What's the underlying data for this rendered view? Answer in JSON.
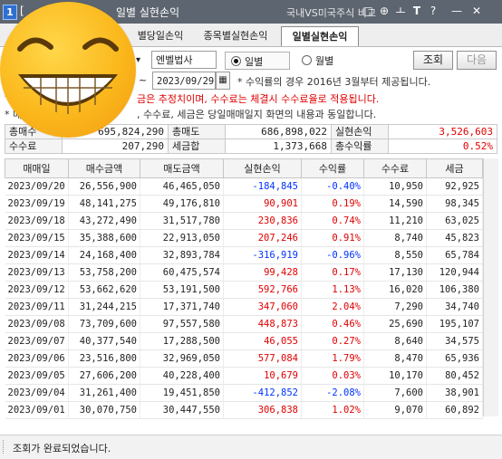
{
  "window": {
    "number": "1",
    "title": "일별 실현손익",
    "title_prefix": "[",
    "compare_label": "국내VS미국주식 비교",
    "buttons": [
      "□",
      "⊕",
      "ㅗ",
      "T",
      "?",
      "—",
      "✕"
    ]
  },
  "tabs": [
    {
      "label": "별당일손익",
      "active": false
    },
    {
      "label": "종목별실현손익",
      "active": false
    },
    {
      "label": "일별실현손익",
      "active": true
    }
  ],
  "controls": {
    "account_name": "엔벨법사",
    "date_sep": "~",
    "date_value": "2023/09/29",
    "radio_daily": "일별",
    "radio_monthly": "월별",
    "radio_selected": "daily",
    "query_button": "조회",
    "next_button": "다음"
  },
  "notes": {
    "line1": "* 수익률의 경우 2016년 3월부터 제공됩니다.",
    "line2": "금은 추정치이며, 수수료는 체결시 수수료율로 적용됩니다.",
    "line3_a": "* 매",
    "line3_b": ", 수수료, 세금은 당일매매일지 화면의 내용과 동일합니다.",
    "line2_prefix": "*"
  },
  "summary": {
    "total_buy_label": "총매수",
    "total_buy": "695,824,290",
    "total_sell_label": "총매도",
    "total_sell": "686,898,022",
    "realized_label": "실현손익",
    "realized": "3,526,603",
    "fee_label": "수수료",
    "fee": "207,290",
    "tax_label": "세금합",
    "tax": "1,373,668",
    "total_return_label": "총수익률",
    "total_return": "0.52%"
  },
  "table": {
    "headers": [
      "매매일",
      "매수금액",
      "매도금액",
      "실현손익",
      "수익률",
      "수수료",
      "세금"
    ],
    "rows": [
      [
        "2023/09/20",
        "26,556,900",
        "46,465,050",
        "-184,845",
        "-0.40%",
        "10,950",
        "92,925"
      ],
      [
        "2023/09/19",
        "48,141,275",
        "49,176,810",
        "90,901",
        "0.19%",
        "14,590",
        "98,345"
      ],
      [
        "2023/09/18",
        "43,272,490",
        "31,517,780",
        "230,836",
        "0.74%",
        "11,210",
        "63,025"
      ],
      [
        "2023/09/15",
        "35,388,600",
        "22,913,050",
        "207,246",
        "0.91%",
        "8,740",
        "45,823"
      ],
      [
        "2023/09/14",
        "24,168,400",
        "32,893,784",
        "-316,919",
        "-0.96%",
        "8,550",
        "65,784"
      ],
      [
        "2023/09/13",
        "53,758,200",
        "60,475,574",
        "99,428",
        "0.17%",
        "17,130",
        "120,944"
      ],
      [
        "2023/09/12",
        "53,662,620",
        "53,191,500",
        "592,766",
        "1.13%",
        "16,020",
        "106,380"
      ],
      [
        "2023/09/11",
        "31,244,215",
        "17,371,740",
        "347,060",
        "2.04%",
        "7,290",
        "34,740"
      ],
      [
        "2023/09/08",
        "73,709,600",
        "97,557,580",
        "448,873",
        "0.46%",
        "25,690",
        "195,107"
      ],
      [
        "2023/09/07",
        "40,377,540",
        "17,288,500",
        "46,055",
        "0.27%",
        "8,640",
        "34,575"
      ],
      [
        "2023/09/06",
        "23,516,800",
        "32,969,050",
        "577,084",
        "1.79%",
        "8,470",
        "65,936"
      ],
      [
        "2023/09/05",
        "27,606,200",
        "40,228,400",
        "10,679",
        "0.03%",
        "10,170",
        "80,452"
      ],
      [
        "2023/09/04",
        "31,261,400",
        "19,451,850",
        "-412,852",
        "-2.08%",
        "7,600",
        "38,901"
      ],
      [
        "2023/09/01",
        "30,070,750",
        "30,447,550",
        "306,838",
        "1.02%",
        "9,070",
        "60,892"
      ]
    ]
  },
  "status": {
    "message": "조회가 완료되었습니다."
  },
  "colors": {
    "positive": "#e00000",
    "negative": "#0033ff",
    "titlebar": "#5d6570"
  }
}
